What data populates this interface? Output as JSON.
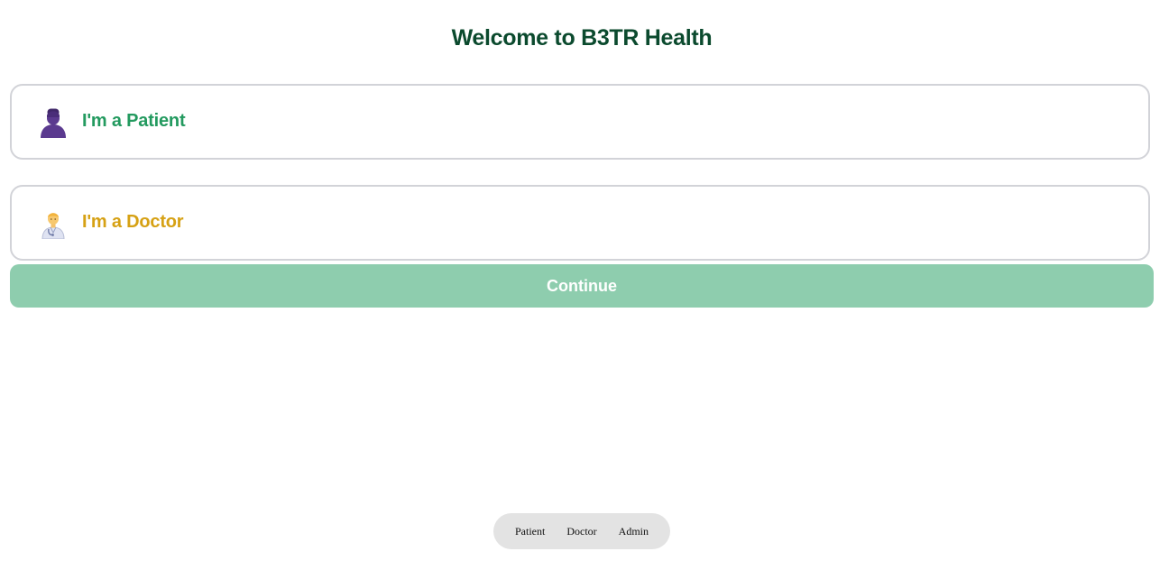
{
  "header": {
    "title": "Welcome to B3TR Health"
  },
  "roles": [
    {
      "label": "I'm a Patient",
      "icon": "person-silhouette-icon",
      "color": "#239a5f"
    },
    {
      "label": "I'm a Doctor",
      "icon": "health-worker-icon",
      "color": "#d6a114"
    }
  ],
  "actions": {
    "continue_label": "Continue",
    "continue_color": "#8ecdae"
  },
  "bottom_nav": {
    "items": [
      "Patient",
      "Doctor",
      "Admin"
    ]
  },
  "colors": {
    "title": "#0b4a2e",
    "card_border": "#d2d3d8",
    "nav_background": "#e3e3e3"
  }
}
